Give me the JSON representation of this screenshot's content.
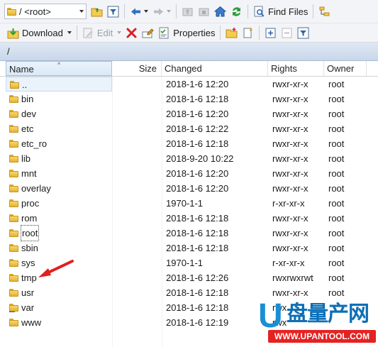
{
  "toolbar_top": {
    "drive_value": "/ <root>",
    "find_files_label": "Find Files"
  },
  "toolbar_files": {
    "download_label": "Download",
    "edit_label": "Edit",
    "properties_label": "Properties"
  },
  "path": "/",
  "columns": {
    "name": "Name",
    "size": "Size",
    "changed": "Changed",
    "rights": "Rights",
    "owner": "Owner"
  },
  "files": [
    {
      "name": "..",
      "size": "",
      "changed": "2018-1-6 12:20",
      "rights": "rwxr-xr-x",
      "owner": "root",
      "type": "parent"
    },
    {
      "name": "bin",
      "size": "",
      "changed": "2018-1-6 12:18",
      "rights": "rwxr-xr-x",
      "owner": "root",
      "type": "folder"
    },
    {
      "name": "dev",
      "size": "",
      "changed": "2018-1-6 12:20",
      "rights": "rwxr-xr-x",
      "owner": "root",
      "type": "folder"
    },
    {
      "name": "etc",
      "size": "",
      "changed": "2018-1-6 12:22",
      "rights": "rwxr-xr-x",
      "owner": "root",
      "type": "folder"
    },
    {
      "name": "etc_ro",
      "size": "",
      "changed": "2018-1-6 12:18",
      "rights": "rwxr-xr-x",
      "owner": "root",
      "type": "folder"
    },
    {
      "name": "lib",
      "size": "",
      "changed": "2018-9-20 10:22",
      "rights": "rwxr-xr-x",
      "owner": "root",
      "type": "folder"
    },
    {
      "name": "mnt",
      "size": "",
      "changed": "2018-1-6 12:20",
      "rights": "rwxr-xr-x",
      "owner": "root",
      "type": "folder"
    },
    {
      "name": "overlay",
      "size": "",
      "changed": "2018-1-6 12:20",
      "rights": "rwxr-xr-x",
      "owner": "root",
      "type": "folder"
    },
    {
      "name": "proc",
      "size": "",
      "changed": "1970-1-1",
      "rights": "r-xr-xr-x",
      "owner": "root",
      "type": "folder"
    },
    {
      "name": "rom",
      "size": "",
      "changed": "2018-1-6 12:18",
      "rights": "rwxr-xr-x",
      "owner": "root",
      "type": "folder"
    },
    {
      "name": "root",
      "size": "",
      "changed": "2018-1-6 12:18",
      "rights": "rwxr-xr-x",
      "owner": "root",
      "type": "folder",
      "focused": true
    },
    {
      "name": "sbin",
      "size": "",
      "changed": "2018-1-6 12:18",
      "rights": "rwxr-xr-x",
      "owner": "root",
      "type": "folder"
    },
    {
      "name": "sys",
      "size": "",
      "changed": "1970-1-1",
      "rights": "r-xr-xr-x",
      "owner": "root",
      "type": "folder"
    },
    {
      "name": "tmp",
      "size": "",
      "changed": "2018-1-6 12:26",
      "rights": "rwxrwxrwt",
      "owner": "root",
      "type": "folder"
    },
    {
      "name": "usr",
      "size": "",
      "changed": "2018-1-6 12:18",
      "rights": "rwxr-xr-x",
      "owner": "root",
      "type": "folder"
    },
    {
      "name": "var",
      "size": "",
      "changed": "2018-1-6 12:18",
      "rights": "rwx",
      "owner": "",
      "type": "link"
    },
    {
      "name": "www",
      "size": "",
      "changed": "2018-1-6 12:19",
      "rights": "rwx",
      "owner": "",
      "type": "folder"
    }
  ],
  "watermark": {
    "big_letter": "U",
    "cn_text": "盘量产网",
    "url": "WWW.UPANTOOL.COM"
  },
  "colors": {
    "folder": "#f0c248",
    "accent": "#1a8fd6",
    "arrow": "#e02020",
    "path_bar": "#cfdcee"
  }
}
